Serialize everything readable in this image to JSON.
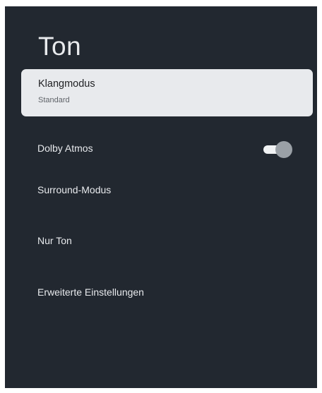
{
  "screen": {
    "title": "Ton"
  },
  "selected_item": {
    "label": "Klangmodus",
    "value": "Standard"
  },
  "items": [
    {
      "label": "Dolby Atmos",
      "toggle_on": true
    },
    {
      "label": "Surround-Modus"
    },
    {
      "label": "Nur Ton"
    },
    {
      "label": "Erweiterte Einstellungen"
    }
  ],
  "colors": {
    "background": "#222830",
    "selected_card": "#e8eaed",
    "text": "#e8eaed"
  }
}
